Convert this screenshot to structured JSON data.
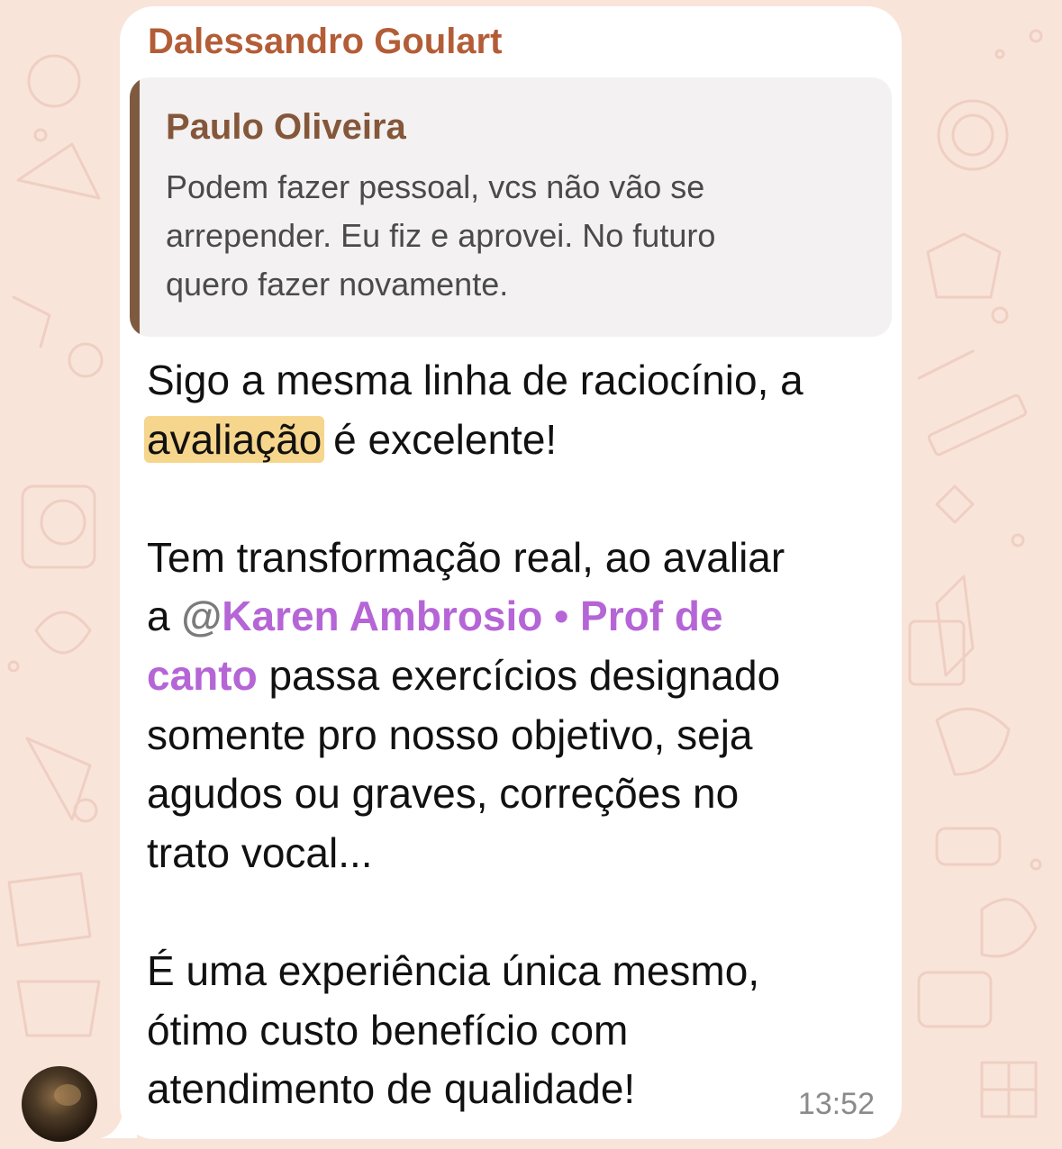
{
  "message": {
    "sender": "Dalessandro Goulart",
    "reply": {
      "author": "Paulo Oliveira",
      "lines": [
        "Podem fazer pessoal, vcs não vão se",
        "arrepender. Eu fiz e aprovei. No futuro",
        "quero fazer novamente."
      ]
    },
    "text": {
      "l1": "Sigo a mesma linha de raciocínio, a",
      "l2_highlight": "avaliação",
      "l2_rest": " é excelente!",
      "l3": "Tem transformação real, ao avaliar",
      "l4_pre": "a ",
      "mention_at": "@",
      "mention_part1": "Karen Ambrosio • Prof de",
      "mention_part2": "canto",
      "l5_rest": " passa exercícios designado",
      "l6": "somente pro nosso objetivo, seja",
      "l7": "agudos ou graves, correções no",
      "l8": "trato vocal...",
      "l9": "É uma experiência única mesmo,",
      "l10": "ótimo custo benefício com",
      "l11": "atendimento de qualidade!"
    },
    "time": "13:52"
  },
  "colors": {
    "sender": "#b35d37",
    "reply_author": "#85573a",
    "reply_bar": "#7e5a41",
    "mention": "#b565d6",
    "highlight": "#f6d58c",
    "wallpaper": "#f9e4da"
  }
}
